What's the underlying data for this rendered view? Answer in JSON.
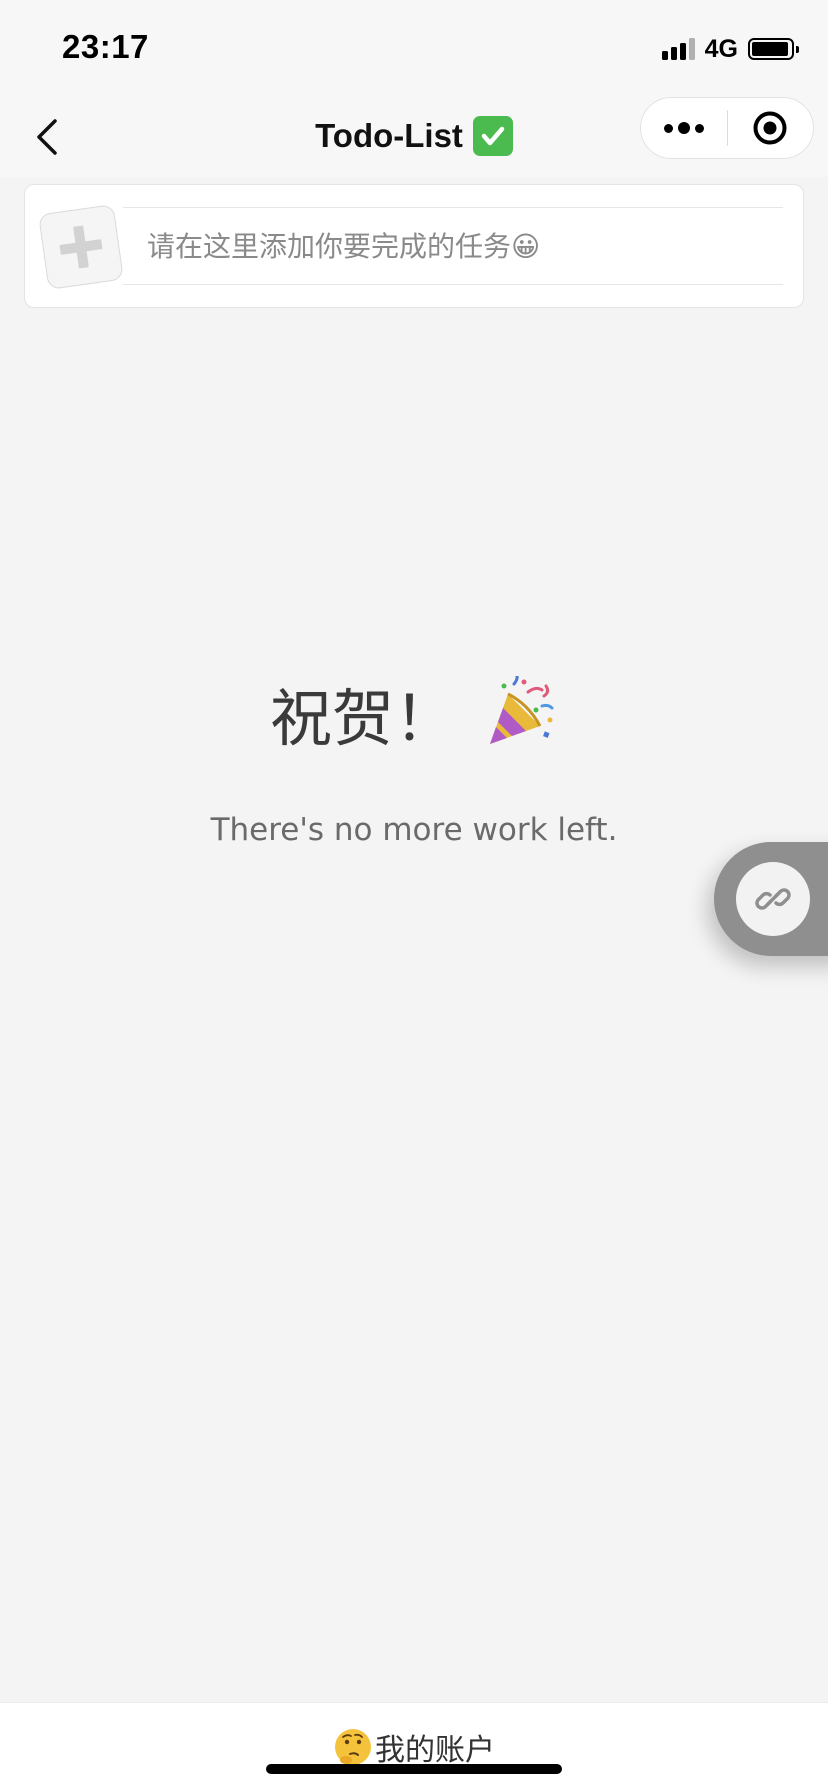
{
  "status_bar": {
    "time": "23:17",
    "network": "4G",
    "signal_bars": 3,
    "battery_level": 0.85
  },
  "nav": {
    "title": "Todo-List",
    "title_emoji": "check-mark-emoji",
    "back_icon": "chevron-left-icon",
    "more_icon": "more-dots-icon",
    "close_icon": "target-circle-icon"
  },
  "input": {
    "add_icon": "plus-icon",
    "placeholder": "请在这里添加你要完成的任务😀",
    "value": ""
  },
  "empty_state": {
    "title": "祝贺！",
    "title_icon": "party-popper-icon",
    "message": "There's no more work left."
  },
  "floating": {
    "icon": "link-icon"
  },
  "bottom_tab": {
    "icon": "thinking-face-icon",
    "label": "我的账户"
  },
  "colors": {
    "background": "#f4f4f4",
    "nav_background": "#f7f7f7",
    "check_green": "#4cbb4f",
    "float_gray": "#8f8f8f"
  }
}
